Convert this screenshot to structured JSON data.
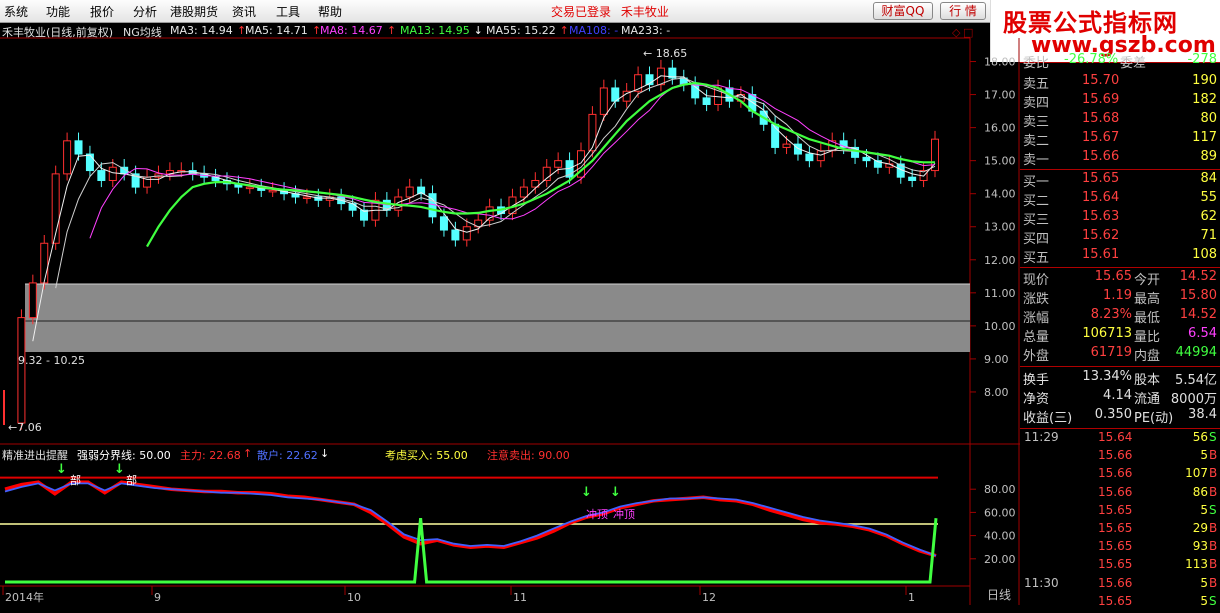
{
  "menu": [
    "系统",
    "功能",
    "报价",
    "分析",
    "港股期货",
    "资讯",
    "工具",
    "帮助"
  ],
  "notice": [
    "交易已登录",
    "禾丰牧业"
  ],
  "buttons": {
    "wealth": "财富QQ",
    "quote": "行 情"
  },
  "watermark": {
    "title": "股票公式指标网",
    "url": "www.gszb.com"
  },
  "main_header": {
    "title": "禾丰牧业(日线,前复权)",
    "indicator": "NG均线",
    "ma": [
      {
        "label": "MA3: 14.94",
        "arrow": "↑",
        "color": "#e8e8e8"
      },
      {
        "label": "MA5: 14.71",
        "arrow": "↑",
        "color": "#e8e8e8"
      },
      {
        "label": "MA8: 14.67",
        "arrow": "↑",
        "color": "#ff40ff"
      },
      {
        "label": "MA13: 14.95",
        "arrow": "↓",
        "color": "#40ff40"
      },
      {
        "label": "MA55: 15.22",
        "arrow": "↑",
        "color": "#e8e8e8"
      },
      {
        "label": "MA108: -",
        "arrow": "",
        "color": "#4040ff"
      },
      {
        "label": "MA233: -",
        "arrow": "",
        "color": "#e8e8e8"
      }
    ]
  },
  "sub_header": {
    "title": "精准进出提醒",
    "line": "强弱分界线: 50.00",
    "main_force": "主力: 22.68",
    "main_arrow": "↑",
    "retail": "散户: 22.62",
    "retail_arrow": "↓",
    "buy_hint": "考虑买入: 55.00",
    "sell_hint": "注意卖出: 90.00"
  },
  "annotations": {
    "high": "18.65",
    "low": "7.06",
    "range": "9.32 - 10.25",
    "bottom_labels": [
      "部",
      "部"
    ],
    "top_labels": [
      "冲顶",
      "冲顶"
    ]
  },
  "price_axis": [
    "18.00",
    "17.00",
    "16.00",
    "15.00",
    "14.00",
    "13.00",
    "12.00",
    "11.00",
    "10.00",
    "9.00",
    "8.00"
  ],
  "sub_axis": [
    "80.00",
    "60.00",
    "40.00",
    "20.00"
  ],
  "date_axis": [
    "2014年",
    "9",
    "10",
    "11",
    "12",
    "1"
  ],
  "bottom_tab": "日线",
  "quote": {
    "weibi": {
      "label": "委比",
      "value": "-26.78%",
      "label2": "委差",
      "value2": "-278"
    },
    "asks": [
      {
        "label": "卖五",
        "price": "15.70",
        "vol": "190"
      },
      {
        "label": "卖四",
        "price": "15.69",
        "vol": "182"
      },
      {
        "label": "卖三",
        "price": "15.68",
        "vol": "80"
      },
      {
        "label": "卖二",
        "price": "15.67",
        "vol": "117"
      },
      {
        "label": "卖一",
        "price": "15.66",
        "vol": "89"
      }
    ],
    "bids": [
      {
        "label": "买一",
        "price": "15.65",
        "vol": "84"
      },
      {
        "label": "买二",
        "price": "15.64",
        "vol": "55"
      },
      {
        "label": "买三",
        "price": "15.63",
        "vol": "62"
      },
      {
        "label": "买四",
        "price": "15.62",
        "vol": "71"
      },
      {
        "label": "买五",
        "price": "15.61",
        "vol": "108"
      }
    ],
    "stats": [
      {
        "l1": "现价",
        "v1": "15.65",
        "c1": "#ff4040",
        "l2": "今开",
        "v2": "14.52",
        "c2": "#ff4040"
      },
      {
        "l1": "涨跌",
        "v1": "1.19",
        "c1": "#ff4040",
        "l2": "最高",
        "v2": "15.80",
        "c2": "#ff4040"
      },
      {
        "l1": "涨幅",
        "v1": "8.23%",
        "c1": "#ff4040",
        "l2": "最低",
        "v2": "14.52",
        "c2": "#ff4040"
      },
      {
        "l1": "总量",
        "v1": "106713",
        "c1": "#ffff40",
        "l2": "量比",
        "v2": "6.54",
        "c2": "#ff40ff"
      },
      {
        "l1": "外盘",
        "v1": "61719",
        "c1": "#ff4040",
        "l2": "内盘",
        "v2": "44994",
        "c2": "#40ff40"
      }
    ],
    "stats2": [
      {
        "l1": "换手",
        "v1": "13.34%",
        "l2": "股本",
        "v2": "5.54亿"
      },
      {
        "l1": "净资",
        "v1": "4.14",
        "l2": "流通",
        "v2": "8000万"
      },
      {
        "l1": "收益(三)",
        "v1": "0.350",
        "l2": "PE(动)",
        "v2": "38.4"
      }
    ],
    "ticks": [
      {
        "time": "11:29",
        "price": "15.64",
        "vol": "56",
        "side": "S",
        "side_color": "#40ff40"
      },
      {
        "time": "",
        "price": "15.66",
        "vol": "5",
        "side": "B",
        "side_color": "#ff4040"
      },
      {
        "time": "",
        "price": "15.66",
        "vol": "107",
        "side": "B",
        "side_color": "#ff4040"
      },
      {
        "time": "",
        "price": "15.66",
        "vol": "86",
        "side": "B",
        "side_color": "#ff4040"
      },
      {
        "time": "",
        "price": "15.65",
        "vol": "5",
        "side": "S",
        "side_color": "#40ff40"
      },
      {
        "time": "",
        "price": "15.65",
        "vol": "29",
        "side": "B",
        "side_color": "#ff4040"
      },
      {
        "time": "",
        "price": "15.65",
        "vol": "93",
        "side": "B",
        "side_color": "#ff4040"
      },
      {
        "time": "",
        "price": "15.65",
        "vol": "113",
        "side": "B",
        "side_color": "#ff4040"
      },
      {
        "time": "11:30",
        "price": "15.66",
        "vol": "5",
        "side": "B",
        "side_color": "#ff4040"
      },
      {
        "time": "",
        "price": "15.65",
        "vol": "5",
        "side": "S",
        "side_color": "#40ff40"
      }
    ]
  },
  "chart_data": [
    {
      "type": "candlestick",
      "title": "禾丰牧业(日线,前复权)",
      "ylim": [
        7.0,
        18.5
      ],
      "x_labels": [
        "2014年",
        "9",
        "10",
        "11",
        "12",
        "1"
      ],
      "closes": [
        7.06,
        10.25,
        11.3,
        12.5,
        14.6,
        15.6,
        15.2,
        14.7,
        14.4,
        14.8,
        14.6,
        14.2,
        14.5,
        14.6,
        14.7,
        14.7,
        14.6,
        14.5,
        14.4,
        14.3,
        14.2,
        14.2,
        14.1,
        14.1,
        14.0,
        13.9,
        13.9,
        13.8,
        13.9,
        13.7,
        13.5,
        13.2,
        13.8,
        13.5,
        13.9,
        14.2,
        14.0,
        13.3,
        12.9,
        12.6,
        13.0,
        13.2,
        13.6,
        13.4,
        13.9,
        14.2,
        14.4,
        14.8,
        15.0,
        14.5,
        15.3,
        16.4,
        17.2,
        16.8,
        17.1,
        17.6,
        17.3,
        17.8,
        17.5,
        17.3,
        16.9,
        16.7,
        17.2,
        16.8,
        17.0,
        16.5,
        16.1,
        15.4,
        15.5,
        15.2,
        15.0,
        15.3,
        15.6,
        15.4,
        15.1,
        15.0,
        14.8,
        14.9,
        14.5,
        14.4,
        14.7,
        15.65
      ],
      "ma13": [
        null,
        null,
        null,
        null,
        null,
        null,
        null,
        null,
        null,
        null,
        null,
        null,
        12.4,
        13.0,
        13.5,
        13.9,
        14.2,
        14.3,
        14.35,
        14.35,
        14.3,
        14.25,
        14.2,
        14.15,
        14.12,
        14.1,
        14.07,
        14.04,
        14.0,
        13.96,
        13.9,
        13.82,
        13.75,
        13.7,
        13.66,
        13.64,
        13.6,
        13.52,
        13.45,
        13.4,
        13.4,
        13.42,
        13.48,
        13.52,
        13.6,
        13.7,
        13.85,
        14.0,
        14.2,
        14.4,
        14.7,
        15.0,
        15.4,
        15.8,
        16.2,
        16.5,
        16.8,
        17.0,
        17.2,
        17.3,
        17.35,
        17.3,
        17.2,
        17.0,
        16.8,
        16.5,
        16.3,
        16.1,
        15.95,
        15.8,
        15.65,
        15.55,
        15.45,
        15.35,
        15.3,
        15.25,
        15.2,
        15.15,
        15.05,
        14.98,
        14.95,
        14.95
      ],
      "markers": {
        "high": "18.65",
        "low": "7.06",
        "range": "9.32 - 10.25"
      }
    },
    {
      "type": "line",
      "title": "精准进出提醒",
      "ylim": [
        0,
        100
      ],
      "levels": {
        "强弱分界线": 50,
        "考虑买入": 55,
        "注意卖出": 90
      },
      "series": [
        {
          "name": "主力",
          "color": "#ff0000",
          "values": [
            80,
            84,
            86,
            76,
            86,
            86,
            77,
            86,
            84,
            82,
            80,
            79,
            78,
            78,
            77,
            77,
            76,
            74,
            73,
            71,
            69,
            67,
            60,
            50,
            39,
            33,
            36,
            32,
            30,
            31,
            30,
            34,
            38,
            44,
            51,
            56,
            59,
            64,
            67,
            70,
            71,
            72,
            73,
            71,
            70,
            67,
            62,
            58,
            54,
            51,
            50,
            48,
            45,
            40,
            33,
            27,
            22.68
          ]
        },
        {
          "name": "散户",
          "color": "#4060ff",
          "values": [
            78,
            82,
            85,
            79,
            85,
            85,
            79,
            85,
            83,
            81,
            80,
            79,
            78,
            77,
            77,
            76,
            75,
            73,
            72,
            71,
            69,
            67,
            62,
            52,
            41,
            36,
            37,
            33,
            31,
            32,
            31,
            35,
            40,
            46,
            52,
            57,
            60,
            65,
            68,
            70,
            72,
            72,
            73,
            72,
            71,
            68,
            64,
            60,
            56,
            53,
            51,
            49,
            46,
            41,
            34,
            28,
            22.62
          ]
        }
      ],
      "signal": {
        "color": "#40ff40",
        "values": [
          0,
          0,
          0,
          0,
          0,
          0,
          0,
          0,
          0,
          0,
          0,
          0,
          0,
          0,
          0,
          0,
          0,
          0,
          0,
          0,
          0,
          0,
          0,
          0,
          0,
          55,
          0,
          0,
          0,
          0,
          0,
          0,
          0,
          0,
          0,
          0,
          0,
          0,
          0,
          0,
          0,
          0,
          0,
          0,
          0,
          0,
          0,
          0,
          0,
          0,
          0,
          0,
          0,
          0,
          0,
          0,
          55
        ]
      }
    }
  ]
}
